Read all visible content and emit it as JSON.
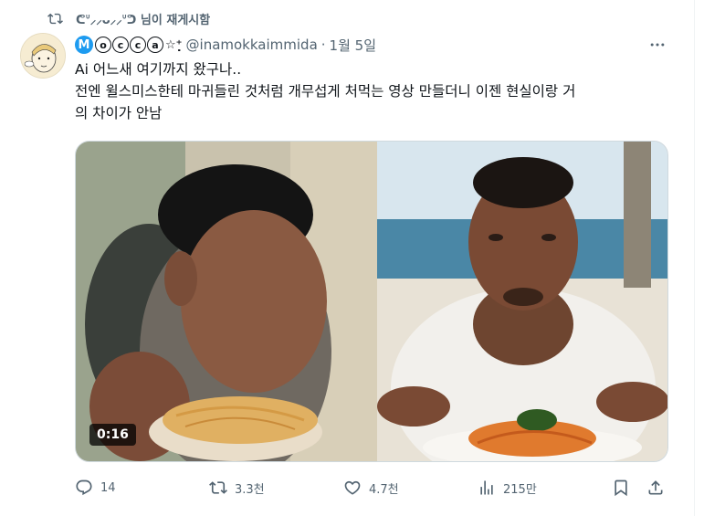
{
  "repost": {
    "icon": "repost-icon",
    "text": "ᕦᐡ⸝⸝ᴗ⸝⸝ᐡᕤ 님이 재게시함"
  },
  "tweet": {
    "display_name": "Mⓞⓒⓒⓐ☆⁺₊",
    "badge_letter": "M",
    "circle_letters": [
      "o",
      "c",
      "c",
      "a"
    ],
    "name_suffix": "☆⁺̣",
    "handle": "@inamokkaimmida",
    "separator": "·",
    "date": "1월 5일",
    "more_icon": "more-icon",
    "text_line1": "Ai 어느새 여기까지 왔구나..",
    "text_line2": "전엔 윌스미스한테 마귀들린 것처럼 개무섭게 처먹는 영상 만들더니 이젠 현실이랑 거",
    "text_line3": "의 차이가 안남"
  },
  "media": {
    "video_duration": "0:16"
  },
  "actions": {
    "reply_count": "14",
    "repost_count": "3.3천",
    "like_count": "4.7천",
    "view_count": "215만"
  },
  "icons": [
    "repost-icon",
    "avatar",
    "more-icon",
    "reply-icon",
    "retweet-icon",
    "like-icon",
    "views-icon",
    "bookmark-icon",
    "share-icon"
  ],
  "colors": {
    "secondary_text": "#536471",
    "accent": "#1d9bf0",
    "text": "#0f1419"
  }
}
